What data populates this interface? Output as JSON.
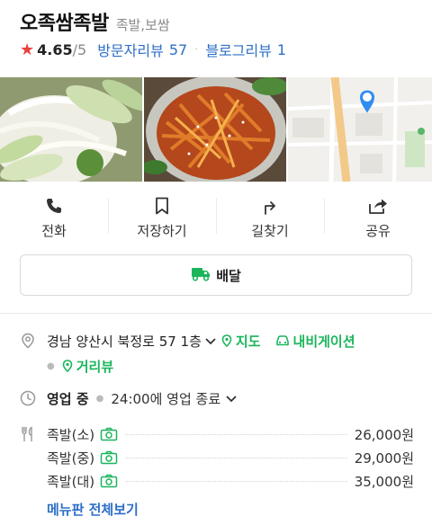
{
  "place": {
    "name": "오족쌈족발",
    "category": "족발,보쌈"
  },
  "rating": {
    "score": "4.65",
    "max": "/5",
    "visitor_review_label": "방문자리뷰",
    "visitor_review_count": "57",
    "blog_review_label": "블로그리뷰",
    "blog_review_count": "1"
  },
  "photos": [
    {
      "icon": "food-photo-onion-cucumber"
    },
    {
      "icon": "food-photo-spicy-salad"
    },
    {
      "icon": "map-thumbnail"
    }
  ],
  "actions": [
    {
      "label": "전화",
      "icon": "phone-icon"
    },
    {
      "label": "저장하기",
      "icon": "bookmark-icon"
    },
    {
      "label": "길찾기",
      "icon": "directions-icon"
    },
    {
      "label": "공유",
      "icon": "share-icon"
    }
  ],
  "delivery": {
    "label": "배달",
    "color": "#1bb55c"
  },
  "address": {
    "text": "경남 양산시 북정로 57 1층",
    "map_link": "지도",
    "navi_link": "내비게이션",
    "street_view_link": "거리뷰"
  },
  "hours": {
    "status": "영업 중",
    "text": "24:00에 영업 종료"
  },
  "menu": {
    "items": [
      {
        "name": "족발(소)",
        "price": "26,000원"
      },
      {
        "name": "족발(중)",
        "price": "29,000원"
      },
      {
        "name": "족발(대)",
        "price": "35,000원"
      }
    ],
    "view_all": "메뉴판 전체보기"
  },
  "colors": {
    "accent_green": "#1bb55c",
    "link_blue": "#2d6fc7",
    "star_red": "#e8413c"
  }
}
